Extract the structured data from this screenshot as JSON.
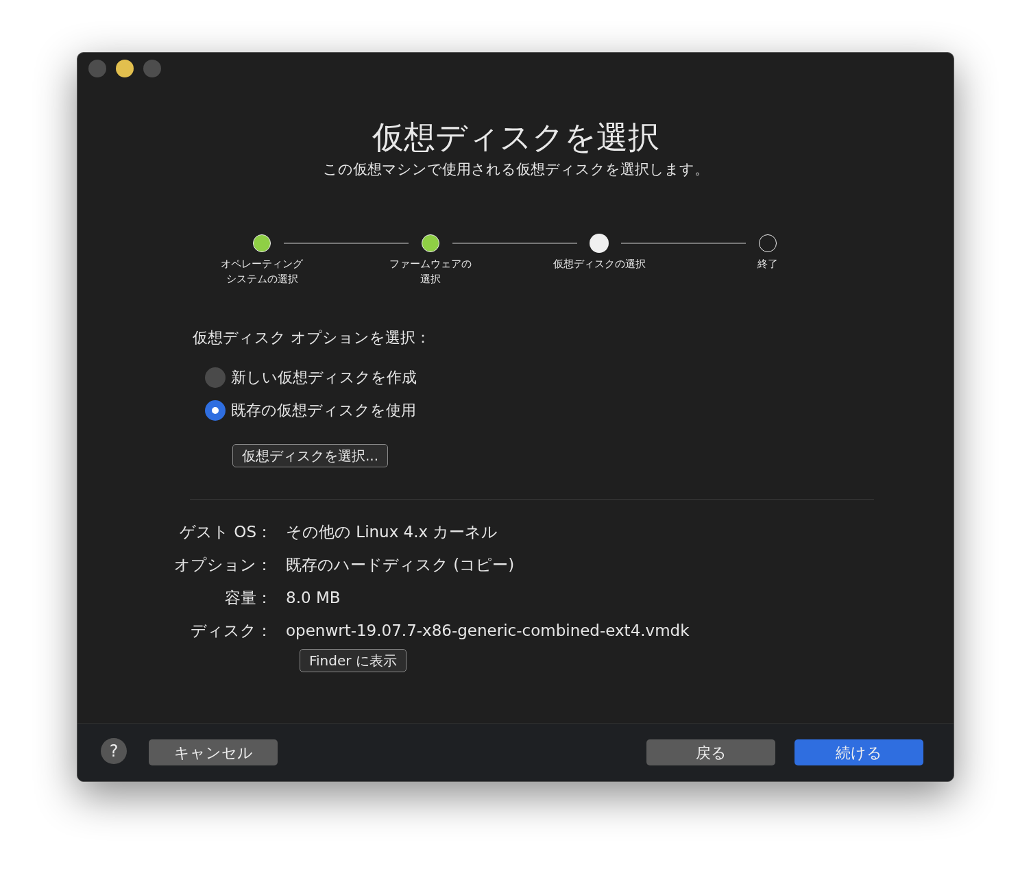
{
  "window_controls": [
    {
      "color": "#4d4d4d"
    },
    {
      "color": "#e2bf4e"
    },
    {
      "color": "#4d4d4d"
    }
  ],
  "title": "仮想ディスクを選択",
  "subtitle": "この仮想マシンで使用される仮想ディスクを選択します。",
  "steps": [
    {
      "lines": [
        "オペレーティング",
        "システムの選択"
      ],
      "completed": true,
      "current": false
    },
    {
      "lines": [
        "ファームウェアの",
        "選択"
      ],
      "completed": true,
      "current": false
    },
    {
      "lines": [
        "仮想ディスクの選択"
      ],
      "completed": false,
      "current": true
    },
    {
      "lines": [
        "終了"
      ],
      "completed": false,
      "current": false
    }
  ],
  "options_label": "仮想ディスク オプションを選択：",
  "options": [
    {
      "label": "新しい仮想ディスクを作成",
      "selected": false
    },
    {
      "label": "既存の仮想ディスクを使用",
      "selected": true
    }
  ],
  "choose_button": "仮想ディスクを選択...",
  "summary": [
    {
      "label": "ゲスト OS：",
      "value": "その他の Linux 4.x カーネル"
    },
    {
      "label": "オプション：",
      "value": "既存のハードディスク (コピー)"
    },
    {
      "label": "容量：",
      "value": "8.0 MB"
    },
    {
      "label": "ディスク：",
      "value": "openwrt-19.07.7-x86-generic-combined-ext4.vmdk"
    }
  ],
  "finder_button": "Finder に表示",
  "footer": {
    "help": "?",
    "cancel": "キャンセル",
    "back": "戻る",
    "continue": "続ける"
  }
}
